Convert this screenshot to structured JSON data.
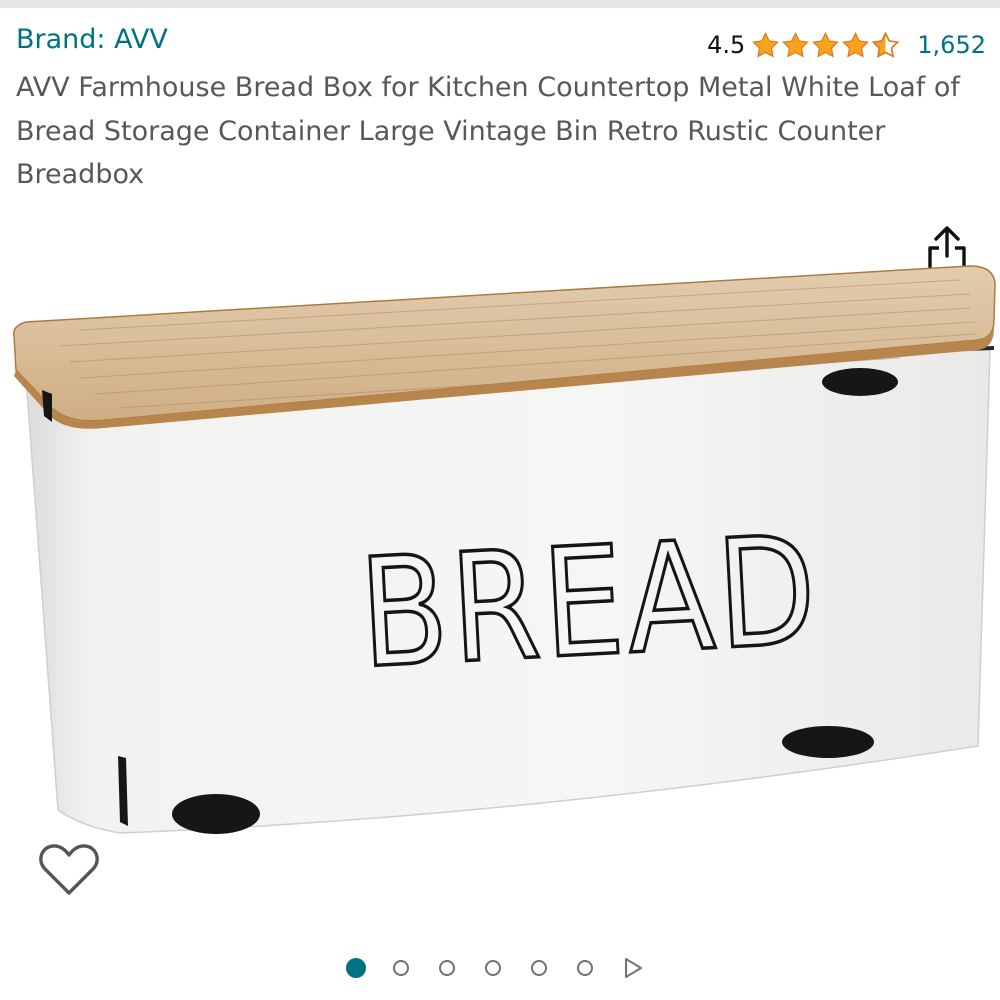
{
  "brand": {
    "label": "Brand: AVV"
  },
  "rating": {
    "value": "4.5",
    "stars": 4.5,
    "max_stars": 5,
    "count": "1,652",
    "star_color": "#f7a31c"
  },
  "product": {
    "title": "AVV Farmhouse Bread Box for Kitchen Countertop Metal White Loaf of Bread Storage Container Large Vintage Bin Retro Rustic Counter Breadbox"
  },
  "image": {
    "label": "BREAD",
    "lid_color": "#c79a62",
    "body_color": "#f4f4f3"
  },
  "icons": {
    "share": "share-icon",
    "wishlist": "heart-outline-icon"
  },
  "carousel": {
    "total": 6,
    "active": 1,
    "accent": "#007185"
  }
}
